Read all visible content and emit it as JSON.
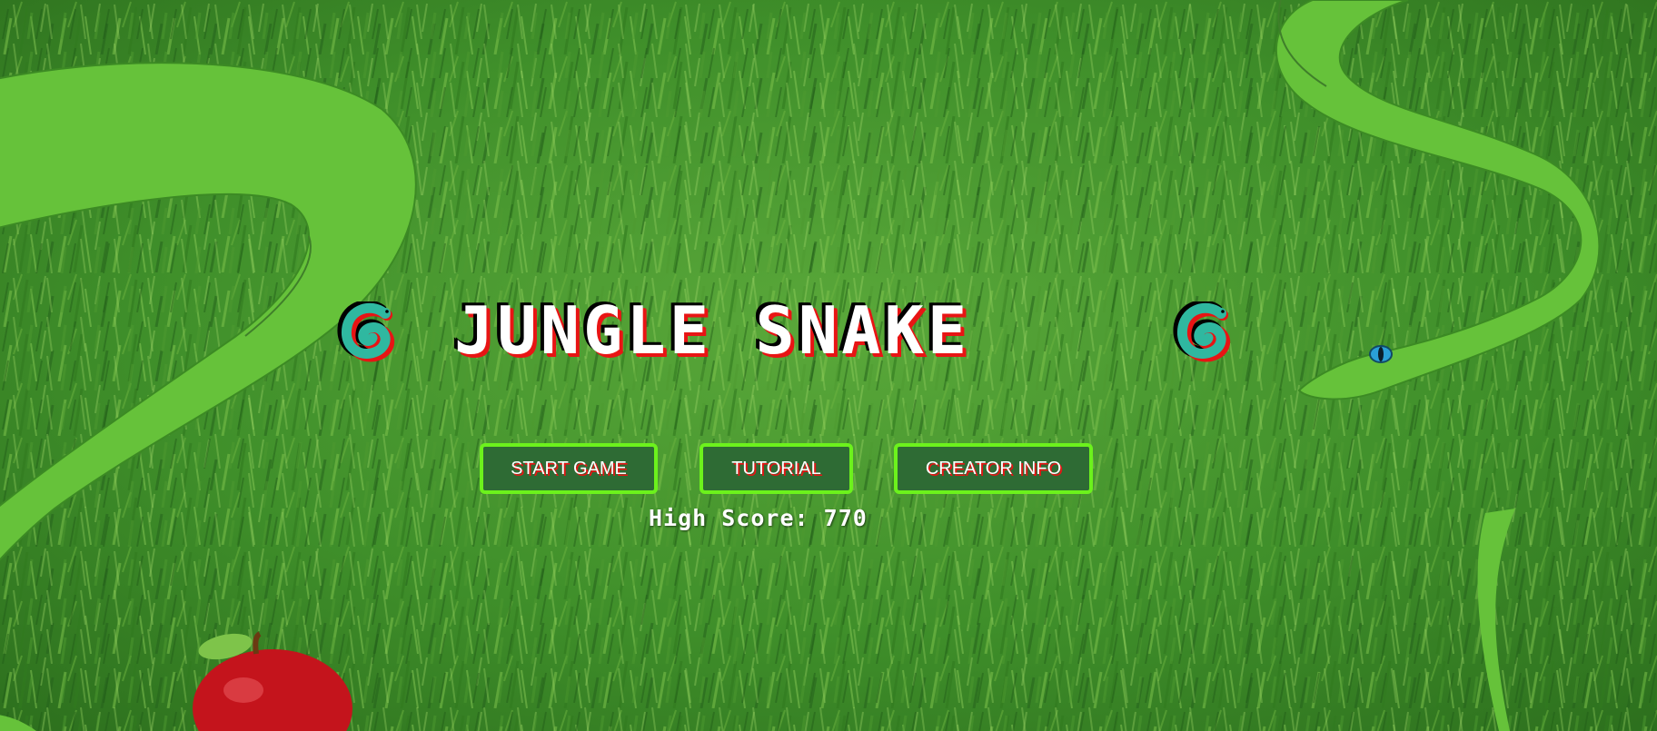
{
  "game": {
    "title": "JUNGLE SNAKE",
    "title_icon": "snake-emoji-icon"
  },
  "menu": {
    "start_label": "START GAME",
    "tutorial_label": "TUTORIAL",
    "creator_label": "CREATOR INFO"
  },
  "score": {
    "label": "High Score:",
    "value": "770"
  },
  "colors": {
    "grass": "#3f8f2a",
    "snake": "#66c23a",
    "button_fill": "#2e6b34",
    "button_border": "#6cf21c",
    "title_shadow": "#e81414"
  }
}
